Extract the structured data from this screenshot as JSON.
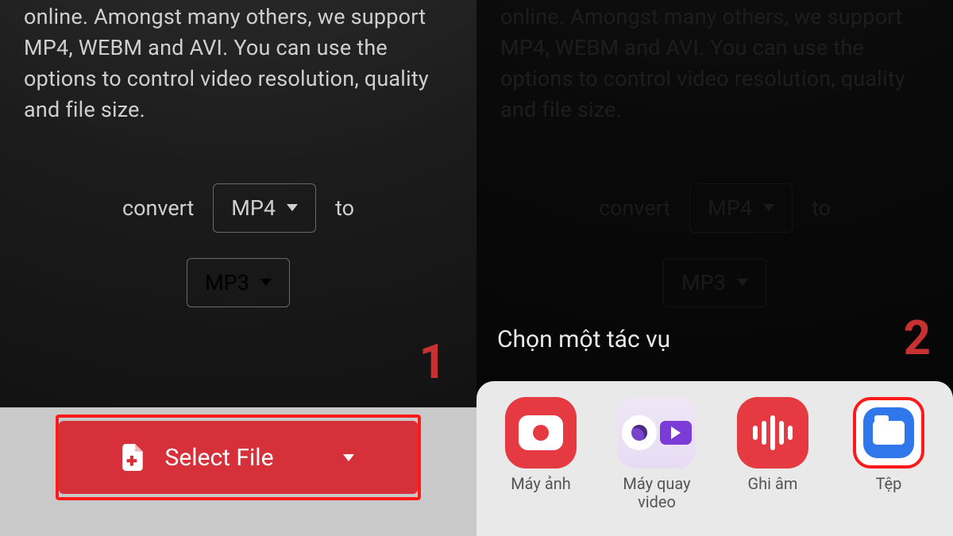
{
  "description": "online. Amongst many others, we support MP4, WEBM and AVI. You can use the options to control video resolution, quality and file size.",
  "convert": {
    "prefix": "convert",
    "from": "MP4",
    "to_word": "to",
    "to": "MP3"
  },
  "steps": {
    "one": "1",
    "two": "2"
  },
  "select_file_label": "Select File",
  "sheet": {
    "title": "Chọn một tác vụ",
    "apps": {
      "camera": "Máy ảnh",
      "video": "Máy quay video",
      "voice": "Ghi âm",
      "files": "Tệp"
    }
  },
  "icons": {
    "file_add": "file-add-icon",
    "chevron_down": "chevron-down-icon",
    "camera": "camera-icon",
    "video_recorder": "video-recorder-icon",
    "voice_wave": "voice-wave-icon",
    "folder": "folder-icon"
  },
  "colors": {
    "accent_red": "#d6303a",
    "highlight_red": "#ff1a1a",
    "files_blue": "#2f77ea"
  }
}
